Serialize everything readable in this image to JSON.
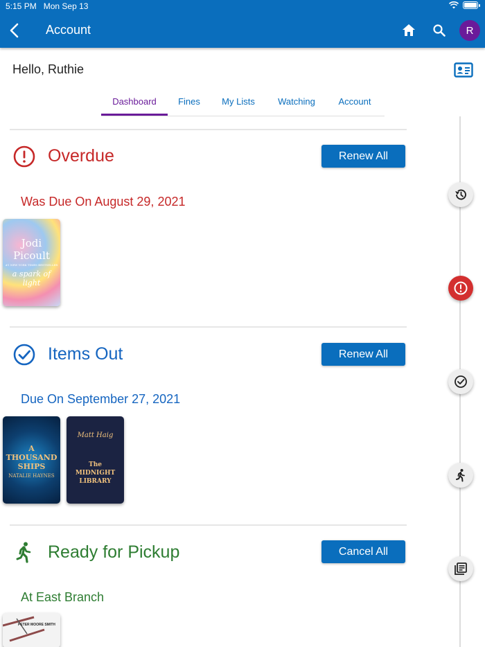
{
  "status_bar": {
    "time": "5:15 PM",
    "date": "Mon Sep 13"
  },
  "header": {
    "title": "Account",
    "avatar_initial": "R"
  },
  "greeting": "Hello, Ruthie",
  "tabs": [
    {
      "label": "Dashboard",
      "active": true
    },
    {
      "label": "Fines"
    },
    {
      "label": "My Lists"
    },
    {
      "label": "Watching"
    },
    {
      "label": "Account"
    }
  ],
  "sections": {
    "overdue": {
      "title": "Overdue",
      "button_label": "Renew All",
      "due_text": "Was Due On August 29, 2021",
      "books": [
        {
          "author": "Jodi Picoult",
          "title": "a spark of light",
          "tagline": "#1 NEW YORK TIMES BESTSELLER"
        }
      ]
    },
    "items_out": {
      "title": "Items Out",
      "button_label": "Renew All",
      "due_text": "Due On September 27, 2021",
      "books": [
        {
          "title": "A THOUSAND SHIPS",
          "author": "NATALIE HAYNES"
        },
        {
          "author": "Matt Haig",
          "title": "The MIDNIGHT LIBRARY"
        }
      ]
    },
    "pickup": {
      "title": "Ready for Pickup",
      "button_label": "Cancel All",
      "location_text": "At East Branch",
      "books": [
        {
          "author": "PETER MOORE SMITH"
        }
      ]
    }
  },
  "colors": {
    "primary": "#0a6ebd",
    "overdue": "#c62828",
    "items_out": "#1565c0",
    "pickup": "#2e7d32",
    "active_tab": "#6a1b9a"
  },
  "icons": [
    "back-icon",
    "home-icon",
    "search-icon",
    "library-card-icon",
    "history-icon",
    "alert-icon",
    "check-circle-icon",
    "walking-icon",
    "book-list-icon",
    "wifi-icon",
    "battery-icon"
  ]
}
